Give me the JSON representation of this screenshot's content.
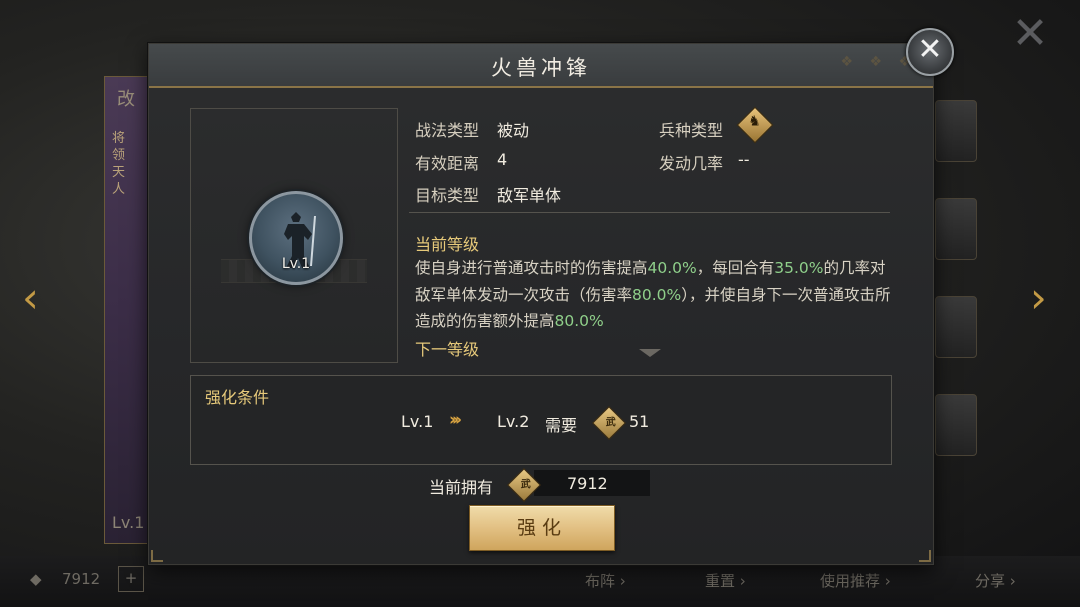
{
  "background": {
    "left_card_glyph": "改",
    "left_card_side_text": "将领天人",
    "left_card_level": "Lv.1",
    "bottom_bar": {
      "coin_count": "7912",
      "plus": "+",
      "item_a": "布阵 ›",
      "item_b": "重置 ›",
      "item_c": "使用推荐 ›",
      "item_d": "分享 ›"
    }
  },
  "modal": {
    "title": "火兽冲锋",
    "close_glyph": "✕",
    "skill": {
      "level_badge": "Lv.1",
      "icon": "warrior-silhouette-icon"
    },
    "info": {
      "type_label": "战法类型",
      "type_value": "被动",
      "troop_label": "兵种类型",
      "troop_icon": "cavalry-icon",
      "range_label": "有效距离",
      "range_value": "4",
      "trigger_label": "发动几率",
      "trigger_value": "--",
      "target_label": "目标类型",
      "target_value": "敌军单体"
    },
    "current_level": {
      "heading": "当前等级",
      "desc_parts": [
        {
          "t": "使自身进行普通攻击时的伤害提高",
          "hl": false
        },
        {
          "t": "40.0%",
          "hl": true
        },
        {
          "t": "，每回合有",
          "hl": false
        },
        {
          "t": "35.0%",
          "hl": true
        },
        {
          "t": "的几率对敌军单体发动一次攻击（伤害率",
          "hl": false
        },
        {
          "t": "80.0%",
          "hl": true
        },
        {
          "t": "），并使自身下一次普通攻击所造成的伤害额外提高",
          "hl": false
        },
        {
          "t": "80.0%",
          "hl": true
        }
      ]
    },
    "next_level": {
      "heading": "下一等级"
    },
    "upgrade": {
      "heading": "强化条件",
      "from_level": "Lv.1",
      "arrow": "›››",
      "to_level": "Lv.2",
      "require_label": "需要",
      "token_glyph": "武",
      "require_amount": "51"
    },
    "owned": {
      "label": "当前拥有",
      "token_glyph": "武",
      "value": "7912"
    },
    "enhance_button": "强化"
  },
  "colors": {
    "accent_gold": "#e6c97a",
    "highlight_green": "#8fcf8a",
    "button_gold": "#e2c083"
  }
}
